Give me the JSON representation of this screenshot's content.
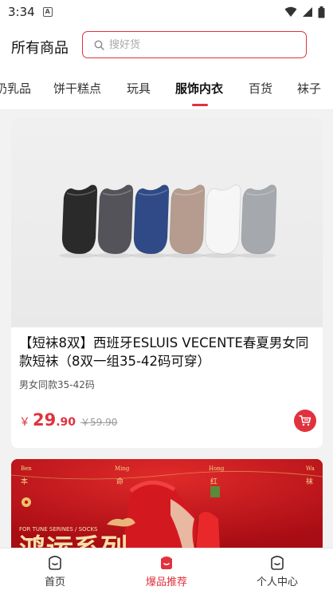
{
  "status_bar": {
    "time": "3:34",
    "notification_letter": "A"
  },
  "header": {
    "title": "所有商品",
    "search_placeholder": "搜好货"
  },
  "tabs": [
    {
      "label": "奶乳品"
    },
    {
      "label": "饼干糕点"
    },
    {
      "label": "玩具"
    },
    {
      "label": "服饰内衣"
    },
    {
      "label": "百货"
    },
    {
      "label": "袜子"
    }
  ],
  "active_tab_index": 3,
  "product": {
    "title": "【短袜8双】西班牙ESLUIS VECENTE春夏男女同款短袜（8双一组35-42码可穿）",
    "subtitle": "男女同款35-42码",
    "currency": "￥",
    "price_int": "29",
    "price_dec": ".90",
    "original_price": "￥59.90",
    "sock_colors": [
      "#2a2a2a",
      "#55535a",
      "#2f4a86",
      "#b59c8e",
      "#f6f6f6",
      "#a5a8ad"
    ]
  },
  "banner": {
    "left_small": "Ben",
    "left_cn": "本",
    "mid_small": "Ming",
    "mid_cn": "命",
    "right_small": "Hong",
    "right_cn": "红",
    "far_small": "Wa",
    "far_cn": "袜",
    "tagline": "FOR TUNE SERINES / SOCKS",
    "big_text": "鸿运系列"
  },
  "bottom_nav": [
    {
      "label": "首页"
    },
    {
      "label": "爆品推荐"
    },
    {
      "label": "个人中心"
    }
  ],
  "colors": {
    "accent": "#e0323e",
    "banner_red": "#c8101a",
    "gold": "#e8c46a"
  }
}
